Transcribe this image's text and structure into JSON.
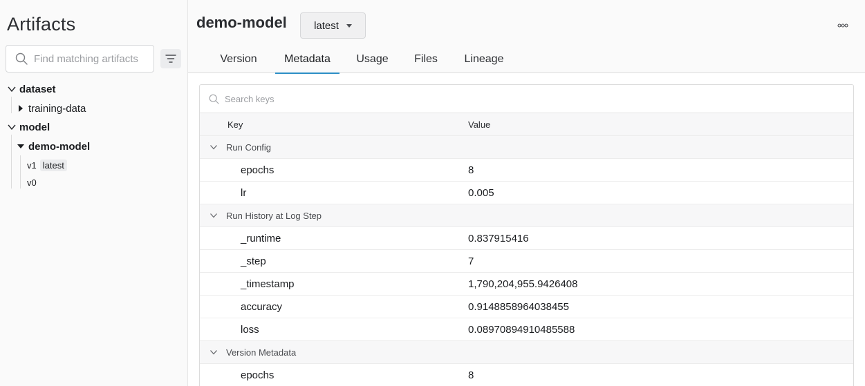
{
  "sidebar": {
    "title": "Artifacts",
    "search_placeholder": "Find matching artifacts",
    "tree": {
      "dataset_label": "dataset",
      "dataset_child": "training-data",
      "model_label": "model",
      "model_child": "demo-model",
      "versions": [
        {
          "label": "v1",
          "badge": "latest"
        },
        {
          "label": "v0"
        }
      ]
    }
  },
  "header": {
    "title": "demo-model",
    "version_select": "latest"
  },
  "tabs": [
    {
      "label": "Version"
    },
    {
      "label": "Metadata"
    },
    {
      "label": "Usage"
    },
    {
      "label": "Files"
    },
    {
      "label": "Lineage"
    }
  ],
  "metadata": {
    "search_placeholder": "Search keys",
    "columns": {
      "key": "Key",
      "value": "Value"
    },
    "groups": [
      {
        "name": "Run Config",
        "rows": [
          {
            "key": "epochs",
            "value": "8"
          },
          {
            "key": "lr",
            "value": "0.005"
          }
        ]
      },
      {
        "name": "Run History at Log Step",
        "rows": [
          {
            "key": "_runtime",
            "value": "0.837915416"
          },
          {
            "key": "_step",
            "value": "7"
          },
          {
            "key": "_timestamp",
            "value": "1,790,204,955.9426408"
          },
          {
            "key": "accuracy",
            "value": "0.9148858964038455"
          },
          {
            "key": "loss",
            "value": "0.08970894910485588"
          }
        ]
      },
      {
        "name": "Version Metadata",
        "rows": [
          {
            "key": "epochs",
            "value": "8"
          }
        ]
      }
    ]
  },
  "colors": {
    "accent": "#2c8ec6",
    "sidebar_bg": "#fafafa",
    "row_group_bg": "#f7f7f8"
  }
}
